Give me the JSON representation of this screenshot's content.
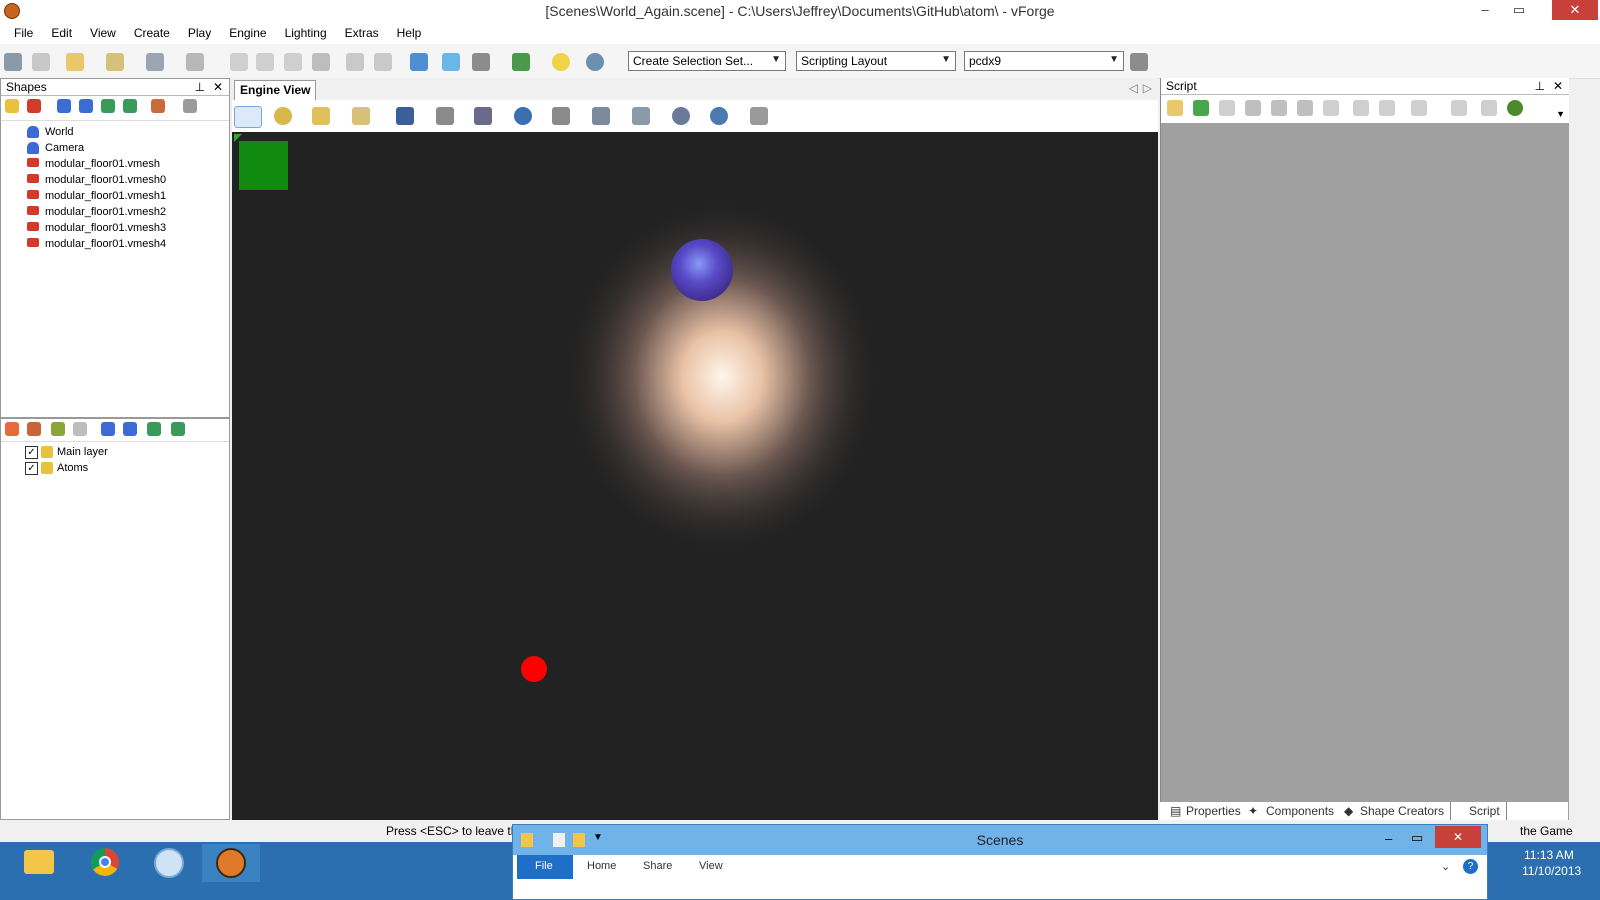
{
  "window": {
    "title": "[Scenes\\World_Again.scene] - C:\\Users\\Jeffrey\\Documents\\GitHub\\atom\\ - vForge",
    "controls": {
      "minimize": "–",
      "restore": "▭",
      "close": "✕"
    }
  },
  "menu": [
    "File",
    "Edit",
    "View",
    "Create",
    "Play",
    "Engine",
    "Lighting",
    "Extras",
    "Help"
  ],
  "toolbar": {
    "selection_set": "Create Selection Set...",
    "layout": "Scripting Layout",
    "platform": "pcdx9"
  },
  "shapes_panel": {
    "title": "Shapes",
    "items": [
      {
        "label": "World",
        "icon": "person-icon"
      },
      {
        "label": "Camera",
        "icon": "person-icon"
      },
      {
        "label": "modular_floor01.vmesh",
        "icon": "mesh-icon"
      },
      {
        "label": "modular_floor01.vmesh0",
        "icon": "mesh-icon"
      },
      {
        "label": "modular_floor01.vmesh1",
        "icon": "mesh-icon"
      },
      {
        "label": "modular_floor01.vmesh2",
        "icon": "mesh-icon"
      },
      {
        "label": "modular_floor01.vmesh3",
        "icon": "mesh-icon"
      },
      {
        "label": "modular_floor01.vmesh4",
        "icon": "mesh-icon"
      }
    ]
  },
  "layers_panel": {
    "items": [
      {
        "label": "Main layer",
        "checked": true
      },
      {
        "label": "Atoms",
        "checked": true
      }
    ]
  },
  "engine_view": {
    "tab": "Engine View",
    "background": "#222222"
  },
  "script_panel": {
    "title": "Script",
    "tabs": [
      "Properties",
      "Components",
      "Shape Creators",
      "Script"
    ]
  },
  "status": {
    "text": "Press <ESC> to leave the",
    "right_text": "the Game"
  },
  "explorer": {
    "title": "Scenes",
    "ribbon_tabs": [
      "File",
      "Home",
      "Share",
      "View"
    ]
  },
  "taskbar": {
    "time": "11:13 AM",
    "date": "11/10/2013"
  },
  "colors": {
    "accent": "#2b6fb0",
    "red_marker": "#ff0000",
    "green_marker": "#118a11"
  }
}
